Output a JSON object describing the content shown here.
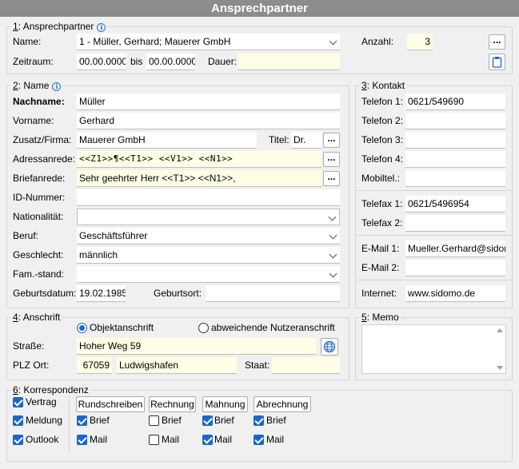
{
  "window": {
    "title": "Ansprechpartner"
  },
  "sec1": {
    "num": "1",
    "title": ": Ansprechpartner",
    "name_label": "Name:",
    "name_value": "1 - Müller, Gerhard; Mauerer GmbH",
    "anzahl_label": "Anzahl:",
    "anzahl_value": "3",
    "zeitraum_label": "Zeitraum:",
    "von": "00.00.0000",
    "bis_label": "bis",
    "bis": "00.00.0000",
    "dauer_label": "Dauer:",
    "dauer_value": "",
    "dots": "..."
  },
  "sec2": {
    "num": "2",
    "title": ": Name",
    "nachname_label": "Nachname:",
    "nachname": "Müller",
    "vorname_label": "Vorname:",
    "vorname": "Gerhard",
    "zusatz_label": "Zusatz/Firma:",
    "zusatz": "Mauerer GmbH",
    "titel_label": "Titel:",
    "titel": "Dr.",
    "adressanrede_label": "Adressanrede:",
    "adressanrede": "<<Z1>>¶<<T1>> <<V1>> <<N1>>",
    "briefanrede_label": "Briefanrede:",
    "briefanrede": "Sehr geehrter Herr <<T1>> <<N1>>,",
    "id_label": "ID-Nummer:",
    "id": "",
    "nationalitaet_label": "Nationalität:",
    "nationalitaet": "",
    "beruf_label": "Beruf:",
    "beruf": "Geschäftsführer",
    "geschlecht_label": "Geschlecht:",
    "geschlecht": "männlich",
    "famstand_label": "Fam.-stand:",
    "famstand": "",
    "geburtsdatum_label": "Geburtsdatum:",
    "geburtsdatum": "19.02.1985",
    "geburtsort_label": "Geburtsort:",
    "geburtsort": "",
    "dots": "..."
  },
  "sec3": {
    "num": "3",
    "title": ": Kontakt",
    "telefon1_label": "Telefon 1:",
    "telefon1": "0621/549690",
    "telefon2_label": "Telefon 2:",
    "telefon2": "",
    "telefon3_label": "Telefon 3:",
    "telefon3": "",
    "telefon4_label": "Telefon 4:",
    "telefon4": "",
    "mobil_label": "Mobiltel.:",
    "mobil": "",
    "telefax1_label": "Telefax 1:",
    "telefax1": "0621/5496954",
    "telefax2_label": "Telefax 2:",
    "telefax2": "",
    "email1_label": "E-Mail 1:",
    "email1": "Mueller.Gerhard@sidomo.de",
    "email2_label": "E-Mail 2:",
    "email2": "",
    "internet_label": "Internet:",
    "internet": "www.sidomo.de"
  },
  "sec4": {
    "num": "4",
    "title": ": Anschrift",
    "radio_objekt": "Objektanschrift",
    "radio_abweichend": "abweichende Nutzeranschrift",
    "strasse_label": "Straße:",
    "strasse": "Hoher Weg 59",
    "plz_label": "PLZ Ort:",
    "plz": "67059",
    "ort": "Ludwigshafen",
    "staat_label": "Staat:",
    "staat": ""
  },
  "sec5": {
    "num": "5",
    "title": ": Memo"
  },
  "sec6": {
    "num": "6",
    "title": ": Korrespondenz",
    "vertrag": "Vertrag",
    "meldung": "Meldung",
    "outlook": "Outlook",
    "columns": [
      {
        "header": "Rundschreiben",
        "brief": "Brief",
        "mail": "Mail"
      },
      {
        "header": "Rechnung",
        "brief": "Brief",
        "mail": "Mail"
      },
      {
        "header": "Mahnung",
        "brief": "Brief",
        "mail": "Mail"
      },
      {
        "header": "Abrechnung",
        "brief": "Brief",
        "mail": "Mail"
      }
    ]
  },
  "colors": {
    "accent": "#1a66cc",
    "title_bg": "#8c8c8c",
    "highlight": "#fffde5"
  },
  "icons": {
    "info": "info-icon",
    "clipboard": "clipboard-icon",
    "globe": "globe-icon"
  }
}
